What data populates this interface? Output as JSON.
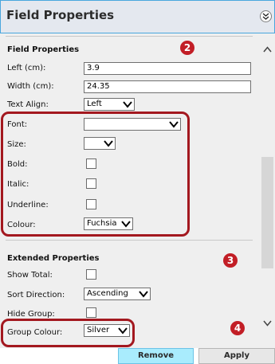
{
  "header": {
    "title": "Field Properties",
    "collapse_icon": "double-chevron-down-icon"
  },
  "field_properties": {
    "title": "Field Properties",
    "left": {
      "label": "Left (cm):",
      "value": "3.9"
    },
    "width": {
      "label": "Width (cm):",
      "value": "24.35"
    },
    "text_align": {
      "label": "Text Align:",
      "value": "Left"
    },
    "font": {
      "label": "Font:",
      "value": ""
    },
    "size": {
      "label": "Size:",
      "value": ""
    },
    "bold": {
      "label": "Bold:"
    },
    "italic": {
      "label": "Italic:"
    },
    "underline": {
      "label": "Underline:"
    },
    "colour": {
      "label": "Colour:",
      "value": "Fuchsia"
    }
  },
  "extended_properties": {
    "title": "Extended Properties",
    "show_total": {
      "label": "Show Total:"
    },
    "sort_direction": {
      "label": "Sort Direction:",
      "value": "Ascending"
    },
    "hide_group": {
      "label": "Hide Group:"
    },
    "group_colour": {
      "label": "Group Colour:",
      "value": "Silver"
    }
  },
  "badges": {
    "two": "2",
    "three": "3",
    "four": "4"
  },
  "buttons": {
    "remove": "Remove",
    "apply": "Apply"
  },
  "colors": {
    "highlight": "#a3181f",
    "badge": "#c21e26",
    "title_border": "#49a7de",
    "remove_bg": "#a9ecfd"
  }
}
